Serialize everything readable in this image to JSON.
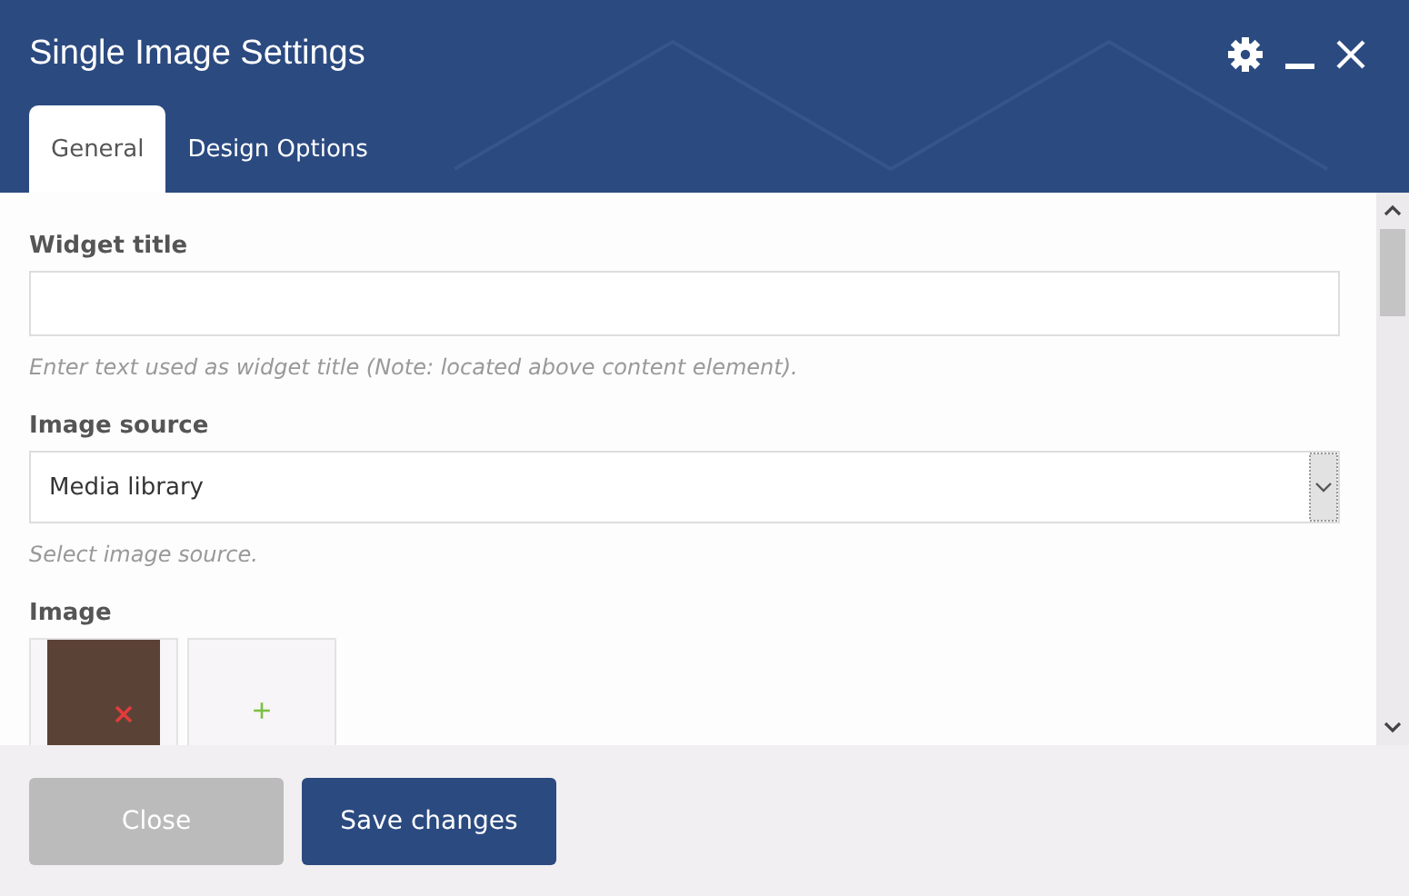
{
  "window": {
    "title": "Single Image Settings"
  },
  "tabs": [
    {
      "label": "General",
      "selected": true
    },
    {
      "label": "Design Options",
      "selected": false
    }
  ],
  "fields": [
    {
      "kind": "text",
      "label": "Widget title",
      "hint": "Enter text used as widget title (Note: located above content element)."
    },
    {
      "kind": "select",
      "label": "Image source",
      "value": "Media library",
      "hint": "Select image source."
    }
  ],
  "image": {
    "label": "Image",
    "add_symbol": "+"
  },
  "buttons": [
    {
      "label": "Close",
      "kind": "secondary"
    },
    {
      "label": "Save changes",
      "kind": "primary"
    }
  ]
}
